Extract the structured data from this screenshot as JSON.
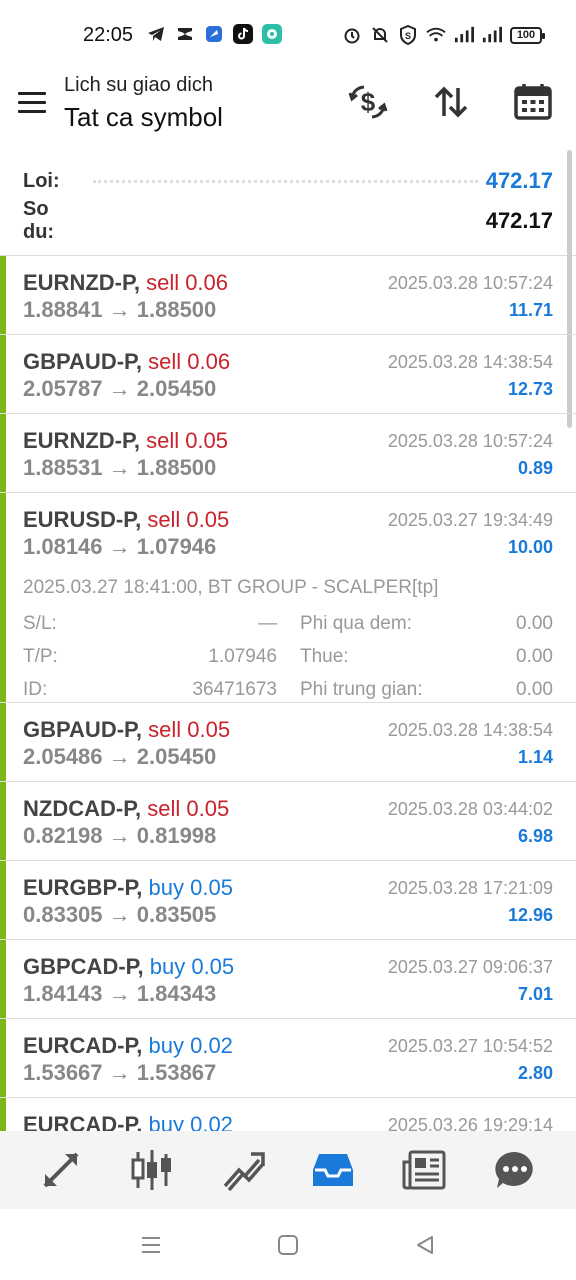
{
  "status": {
    "time": "22:05",
    "battery": "100"
  },
  "header": {
    "subtitle": "Lich su giao dich",
    "title": "Tat ca symbol"
  },
  "summary": {
    "loi_label": "Loi:",
    "loi_value": "472.17",
    "sodu_label": "So du:",
    "sodu_value": "472.17"
  },
  "colors": {
    "accent_blue": "#1a7ad9",
    "sell_red": "#c8232c",
    "buy_bar_green": "#7cb518"
  },
  "deals": [
    {
      "symbol": "EURNZD-P,",
      "side": "sell 0.06",
      "side_type": "sell",
      "prices": "1.88841 → 1.88500",
      "time": "2025.03.28 10:57:24",
      "profit": "11.71"
    },
    {
      "symbol": "GBPAUD-P,",
      "side": "sell 0.06",
      "side_type": "sell",
      "prices": "2.05787 → 2.05450",
      "time": "2025.03.28 14:38:54",
      "profit": "12.73"
    },
    {
      "symbol": "EURNZD-P,",
      "side": "sell 0.05",
      "side_type": "sell",
      "prices": "1.88531 → 1.88500",
      "time": "2025.03.28 10:57:24",
      "profit": "0.89"
    },
    {
      "symbol": "EURUSD-P,",
      "side": "sell 0.05",
      "side_type": "sell",
      "prices": "1.08146 → 1.07946",
      "time": "2025.03.27 19:34:49",
      "profit": "10.00",
      "details": {
        "comment": "2025.03.27 18:41:00, BT GROUP - SCALPER[tp]",
        "rows": [
          {
            "k1": "S/L:",
            "v1": "—",
            "k2": "Phi qua dem:",
            "v2": "0.00"
          },
          {
            "k1": "T/P:",
            "v1": "1.07946",
            "k2": "Thue:",
            "v2": "0.00"
          },
          {
            "k1": "ID:",
            "v1": "36471673",
            "k2": "Phi trung gian:",
            "v2": "0.00"
          }
        ]
      }
    },
    {
      "symbol": "GBPAUD-P,",
      "side": "sell 0.05",
      "side_type": "sell",
      "prices": "2.05486 → 2.05450",
      "time": "2025.03.28 14:38:54",
      "profit": "1.14"
    },
    {
      "symbol": "NZDCAD-P,",
      "side": "sell 0.05",
      "side_type": "sell",
      "prices": "0.82198 → 0.81998",
      "time": "2025.03.28 03:44:02",
      "profit": "6.98"
    },
    {
      "symbol": "EURGBP-P,",
      "side": "buy 0.05",
      "side_type": "buy",
      "prices": "0.83305 → 0.83505",
      "time": "2025.03.28 17:21:09",
      "profit": "12.96"
    },
    {
      "symbol": "GBPCAD-P,",
      "side": "buy 0.05",
      "side_type": "buy",
      "prices": "1.84143 → 1.84343",
      "time": "2025.03.27 09:06:37",
      "profit": "7.01"
    },
    {
      "symbol": "EURCAD-P,",
      "side": "buy 0.02",
      "side_type": "buy",
      "prices": "1.53667 → 1.53867",
      "time": "2025.03.27 10:54:52",
      "profit": "2.80"
    },
    {
      "symbol": "EURCAD-P,",
      "side": "buy 0.02",
      "side_type": "buy",
      "prices": "",
      "time": "2025.03.26 19:29:14",
      "profit": ""
    }
  ],
  "bottom_nav": [
    {
      "name": "quotes-icon",
      "active": false
    },
    {
      "name": "chart-candles-icon",
      "active": false
    },
    {
      "name": "trade-icon",
      "active": false
    },
    {
      "name": "history-icon",
      "active": true
    },
    {
      "name": "news-icon",
      "active": false
    },
    {
      "name": "messages-icon",
      "active": false
    }
  ]
}
